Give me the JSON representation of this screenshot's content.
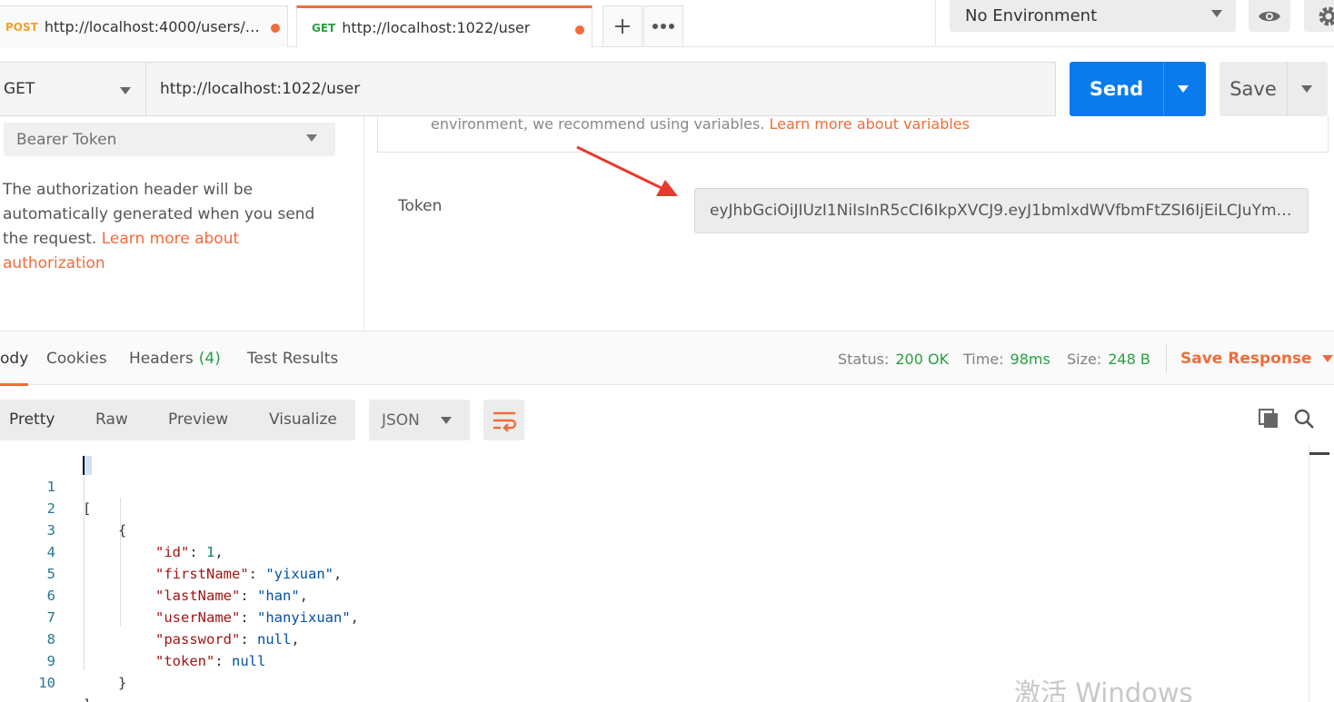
{
  "tabs": [
    {
      "method": "POST",
      "method_color": "#f2a024",
      "url": "http://localhost:4000/users/au..."
    },
    {
      "method": "GET",
      "method_color": "#26a042",
      "url": "http://localhost:1022/user"
    }
  ],
  "tab_actions": {
    "add_icon": "plus-icon",
    "more_icon": "ellipsis-icon"
  },
  "environment": {
    "selected": "No Environment",
    "eye_icon": "eye-icon",
    "settings_icon": "gear-icon"
  },
  "request": {
    "method": "GET",
    "url": "http://localhost:1022/user",
    "send_label": "Send",
    "save_label": "Save"
  },
  "auth": {
    "type": "Bearer Token",
    "description": "The authorization header will be automatically generated when you send the request. ",
    "learn_more": "Learn more about authorization",
    "notice_text": "environment, we recommend using variables. ",
    "notice_link": "Learn more about variables",
    "token_label": "Token",
    "token_value": "eyJhbGciOiJIUzI1NiIsInR5cCI6IkpXVCJ9.eyJ1bmlxdWVfbmFtZSI6IjEiLCJuYmYiOiE1..."
  },
  "response": {
    "tabs": [
      {
        "label": "ody",
        "active": true
      },
      {
        "label": "Cookies"
      },
      {
        "label": "Headers",
        "count": "(4)"
      },
      {
        "label": "Test Results"
      }
    ],
    "status_label": "Status:",
    "status": "200 OK",
    "time_label": "Time:",
    "time": "98ms",
    "size_label": "Size:",
    "size": "248 B",
    "save_response": "Save Response",
    "views": [
      "Pretty",
      "Raw",
      "Preview",
      "Visualize"
    ],
    "format": "JSON",
    "copy_icon": "copy-icon",
    "search_icon": "search-icon"
  },
  "code": {
    "line_numbers": [
      "1",
      "2",
      "3",
      "4",
      "5",
      "6",
      "7",
      "8",
      "9",
      "10"
    ],
    "open_bracket": "[",
    "open_brace": "{",
    "fields": [
      {
        "key": "\"id\"",
        "value": "1",
        "type": "number"
      },
      {
        "key": "\"firstName\"",
        "value": "\"yixuan\"",
        "type": "string"
      },
      {
        "key": "\"lastName\"",
        "value": "\"han\"",
        "type": "string"
      },
      {
        "key": "\"userName\"",
        "value": "\"hanyixuan\"",
        "type": "string"
      },
      {
        "key": "\"password\"",
        "value": "null",
        "type": "null"
      },
      {
        "key": "\"token\"",
        "value": "null",
        "type": "null"
      }
    ],
    "close_brace": "}",
    "close_bracket": "]"
  },
  "watermark": "激活 Windows",
  "colors": {
    "accent": "#f26b3a",
    "send": "#097bed",
    "success": "#26a042"
  }
}
